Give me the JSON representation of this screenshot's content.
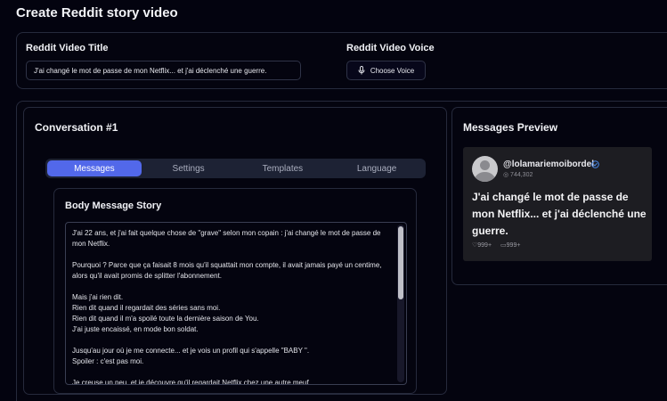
{
  "page": {
    "title": "Create Reddit story video"
  },
  "video": {
    "title_label": "Reddit Video Title",
    "title_value": "J'ai changé le mot de passe de mon Netflix... et j'ai déclenché une guerre.",
    "voice_label": "Reddit Video Voice",
    "voice_button": "Choose Voice"
  },
  "conversation": {
    "title": "Conversation #1",
    "tabs": [
      "Messages",
      "Settings",
      "Templates",
      "Language"
    ],
    "body_title": "Body Message Story",
    "story_paragraphs": [
      "J'ai 22 ans, et j'ai fait quelque chose de \"grave\" selon mon copain : j'ai changé le mot de passe de mon Netflix.",
      "Pourquoi ? Parce que ça faisait 8 mois qu'il squattait mon compte, il avait jamais payé un centime, alors qu'il avait promis de splitter l'abonnement.",
      "Mais j'ai rien dit.\nRien dit quand il regardait des séries sans moi.\nRien dit quand il m'a spoilé toute la dernière saison de You.\nJ'ai juste encaissé, en mode bon soldat.",
      "Jusqu'au jour où je me connecte... et je vois un profil qui s'appelle \"BABY \".\nSpoiler : c'est pas moi.",
      "Je creuse un peu, et je découvre qu'il regardait Netflix chez une autre meuf"
    ]
  },
  "preview": {
    "title": "Messages Preview",
    "username": "@lolamariemoibordel",
    "meta": "◎ 744,302",
    "headline": "J'ai changé le mot de passe de mon Netflix... et j'ai déclenché une guerre.",
    "likes": "♡999+",
    "comments": "▭999+"
  },
  "colors": {
    "accent": "#5268ea",
    "background": "#03030f",
    "card": "#1d1d22"
  }
}
